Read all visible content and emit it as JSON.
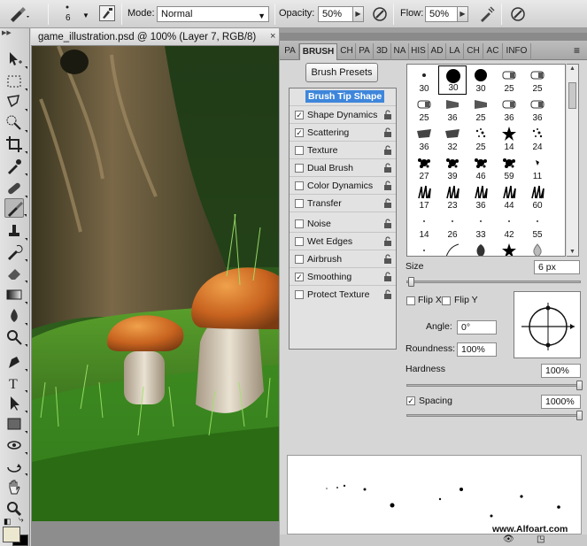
{
  "options_bar": {
    "brush_size": "6",
    "mode_label": "Mode:",
    "mode_value": "Normal",
    "opacity_label": "Opacity:",
    "opacity_value": "50%",
    "flow_label": "Flow:",
    "flow_value": "50%"
  },
  "document": {
    "title": "game_illustration.psd @ 100% (Layer 7, RGB/8)",
    "close": "×"
  },
  "panel_tabs": [
    "PA",
    "BRUSH",
    "CH",
    "PA",
    "3D",
    "NA",
    "HIS",
    "AD",
    "LA",
    "CH",
    "AC",
    "INFO"
  ],
  "brush_panel": {
    "presets_button": "Brush Presets",
    "options": [
      {
        "label": "Brush Tip Shape",
        "checked": null,
        "head": true
      },
      {
        "label": "Shape Dynamics",
        "checked": true
      },
      {
        "label": "Scattering",
        "checked": true
      },
      {
        "label": "Texture",
        "checked": false
      },
      {
        "label": "Dual Brush",
        "checked": false
      },
      {
        "label": "Color Dynamics",
        "checked": false
      },
      {
        "label": "Transfer",
        "checked": false
      },
      {
        "label": "Noise",
        "checked": false
      },
      {
        "label": "Wet Edges",
        "checked": false
      },
      {
        "label": "Airbrush",
        "checked": false
      },
      {
        "label": "Smoothing",
        "checked": true
      },
      {
        "label": "Protect Texture",
        "checked": false
      }
    ],
    "brush_sizes": [
      "30",
      "30",
      "30",
      "25",
      "25",
      "25",
      "36",
      "25",
      "36",
      "36",
      "36",
      "32",
      "25",
      "14",
      "24",
      "27",
      "39",
      "46",
      "59",
      "11",
      "17",
      "23",
      "36",
      "44",
      "60",
      "14",
      "26",
      "33",
      "42",
      "55",
      "",
      "",
      "",
      "",
      ""
    ],
    "size_label": "Size",
    "size_value": "6 px",
    "flip_x": "Flip X",
    "flip_y": "Flip Y",
    "angle_label": "Angle:",
    "angle_value": "0°",
    "roundness_label": "Roundness:",
    "roundness_value": "100%",
    "hardness_label": "Hardness",
    "hardness_value": "100%",
    "spacing_label": "Spacing",
    "spacing_value": "1000%"
  },
  "watermark": "www.Alfoart.com",
  "colors": {
    "foreground": "#ece7cf",
    "background": "#000000",
    "selection": "#3e86db"
  }
}
